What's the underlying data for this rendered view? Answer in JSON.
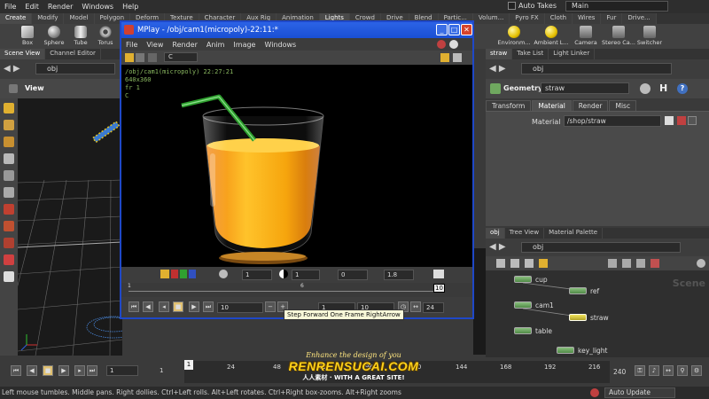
{
  "menubar": {
    "items": [
      "File",
      "Edit",
      "Render",
      "Windows",
      "Help"
    ],
    "auto_takes": "Auto Takes",
    "desktop": "Main"
  },
  "shelf": {
    "tabs": [
      "Create",
      "Modify",
      "Model",
      "Polygon",
      "Deform",
      "Texture",
      "Character",
      "Aux Rig",
      "Animation",
      "Lights",
      "Crowd",
      "Drive",
      "Blend",
      "Partic...",
      "Volum...",
      "Pyro FX",
      "Cloth",
      "Wires",
      "Fur",
      "Drive..."
    ],
    "tools": [
      "Box",
      "Sphere",
      "Tube",
      "Torus",
      "Environm...",
      "Ambient L...",
      "Camera",
      "Stereo Ca...",
      "Switcher"
    ]
  },
  "left_pane": {
    "tabs": [
      "Scene View",
      "Channel Editor"
    ],
    "path": "obj",
    "view_title": "View"
  },
  "mplay": {
    "title": "MPlay - /obj/cam1(micropoly)-22:11:*",
    "menu": [
      "File",
      "View",
      "Render",
      "Anim",
      "Image",
      "Windows"
    ],
    "channel": "C",
    "info_lines": [
      "/obj/cam1(micropoly) 22:27:21",
      "640x360",
      "fr 1",
      "C"
    ],
    "fields": {
      "f1": "1",
      "f2": "1",
      "f3": "0",
      "f4": "1.8"
    },
    "timeline_marks": [
      "1",
      "6",
      "10"
    ],
    "frame_current": "10",
    "range_start": "1",
    "range_end": "10",
    "fps": "24"
  },
  "tooltip": "Step Forward One Frame   RightArrow",
  "param_pane": {
    "tabs": [
      "straw",
      "Take List",
      "Light Linker"
    ],
    "path": "obj",
    "node_type": "Geometry",
    "node_name": "straw",
    "param_tabs": [
      "Transform",
      "Material",
      "Render",
      "Misc"
    ],
    "material_label": "Material",
    "material_value": "/shop/straw"
  },
  "network": {
    "tabs": [
      "obj",
      "Tree View",
      "Material Palette"
    ],
    "path": "obj",
    "watermark": "Scene",
    "nodes": [
      "cup",
      "ref",
      "cam1",
      "straw",
      "table",
      "key_light"
    ]
  },
  "timeline": {
    "start_field": "1",
    "start": "1",
    "current": "1",
    "ticks": [
      "24",
      "48",
      "72",
      "96",
      "120",
      "144",
      "168",
      "192",
      "216"
    ],
    "end": "240"
  },
  "status": {
    "message": "Left mouse tumbles. Middle pans. Right dollies. Ctrl+Left rolls. Alt+Left rotates. Ctrl+Right box-zooms. Alt+Right zooms",
    "auto_update": "Auto Update"
  },
  "logo": {
    "line1": "Enhance the design of you",
    "line2": "RENRENSUCAI.COM",
    "line3": "人人素材 · WITH A GREAT SITE!"
  },
  "colors": {
    "window_blue": "#1a4fd4",
    "node_green": "#6fa85f",
    "node_selected": "#e0d040",
    "juice": "#f5a20a",
    "straw": "#2fa02f"
  }
}
